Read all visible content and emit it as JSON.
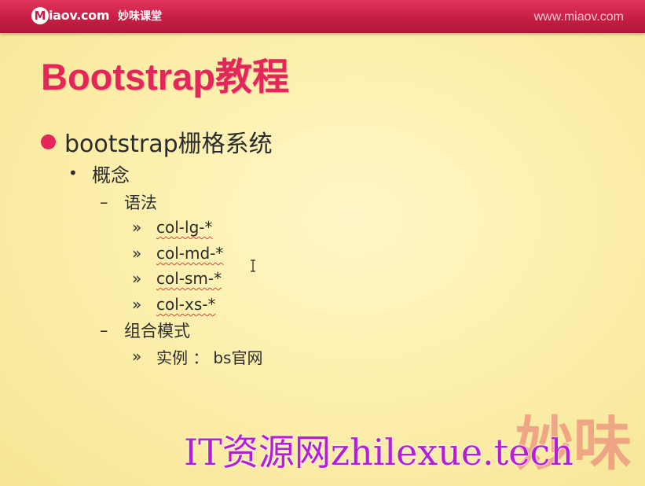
{
  "header": {
    "logo_badge": "M",
    "logo_text": "iaov.com",
    "logo_cn": "妙味课堂",
    "site_url": "www.miaov.com"
  },
  "slide": {
    "title": "Bootstrap教程",
    "bullet": "bootstrap栅格系统",
    "concept_marker": "•",
    "concept": "概念",
    "sub_marker": "–",
    "item_marker": "»",
    "syntax": {
      "label": "语法",
      "items": [
        "col-lg-*",
        "col-md-*",
        "col-sm-*",
        "col-xs-*"
      ]
    },
    "combo": {
      "label": "组合模式",
      "example_label": "实例 ：",
      "example_link": "bs官网"
    }
  },
  "watermarks": {
    "brand_cn": "妙味",
    "site": "IT资源网zhilexue.tech"
  },
  "colors": {
    "accent": "#e5265a",
    "header_bar": "#c81e45",
    "background": "#fdf0a8",
    "watermark": "#b51ed6"
  },
  "icons": {
    "text_cursor": "i-beam-cursor-icon",
    "bullet": "pink-dot-bullet-icon"
  }
}
